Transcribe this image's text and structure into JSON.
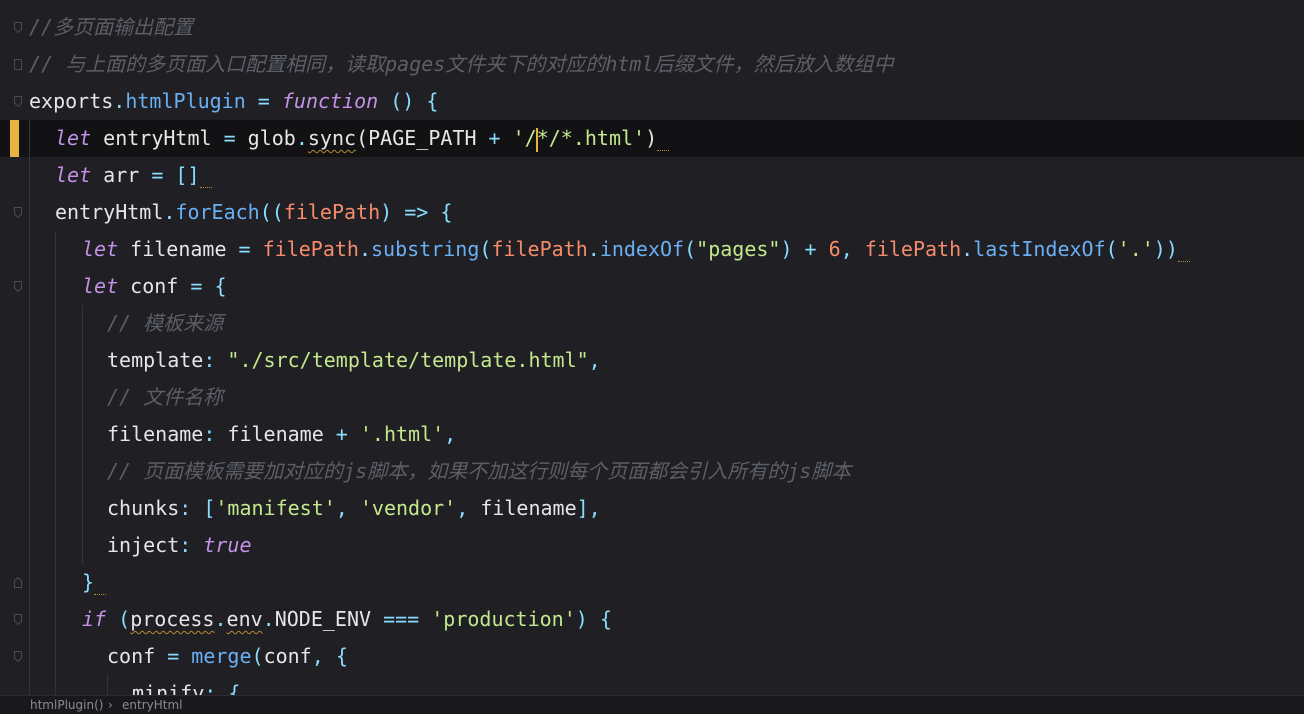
{
  "lines": [
    {
      "tokens": [
        {
          "t": "//多页面输出配置",
          "c": "comment"
        }
      ]
    },
    {
      "tokens": [
        {
          "t": "// 与上面的多页面入口配置相同，读取pages文件夹下的对应的html后缀文件，然后放入数组中",
          "c": "comment"
        }
      ]
    },
    {
      "tokens": [
        {
          "t": "exports",
          "c": "var"
        },
        {
          "t": ".",
          "c": "punc"
        },
        {
          "t": "htmlPlugin",
          "c": "fn"
        },
        {
          "t": " = ",
          "c": "op"
        },
        {
          "t": "function",
          "c": "kw"
        },
        {
          "t": " () {",
          "c": "punc"
        }
      ]
    },
    {
      "tokens": [
        {
          "t": "let",
          "c": "kw"
        },
        {
          "t": " entryHtml ",
          "c": "var"
        },
        {
          "t": "=",
          "c": "op"
        },
        {
          "t": " glob",
          "c": "var"
        },
        {
          "t": ".",
          "c": "punc"
        },
        {
          "t": "sync",
          "c": "var",
          "sq": true
        },
        {
          "t": "(",
          "c": "var"
        },
        {
          "t": "PAGE_PATH ",
          "c": "var"
        },
        {
          "t": "+",
          "c": "op"
        },
        {
          "t": " '",
          "c": "str"
        },
        {
          "t": "/",
          "c": "str"
        },
        {
          "t": "CARET",
          "c": "caret"
        },
        {
          "t": "*/*.html'",
          "c": "str"
        },
        {
          "t": ")",
          "c": "var"
        },
        {
          "t": "WARN",
          "c": "warn"
        }
      ]
    },
    {
      "tokens": [
        {
          "t": "let",
          "c": "kw"
        },
        {
          "t": " arr ",
          "c": "var"
        },
        {
          "t": "=",
          "c": "op"
        },
        {
          "t": " []",
          "c": "punc"
        },
        {
          "t": "WARN",
          "c": "warn"
        }
      ]
    },
    {
      "tokens": [
        {
          "t": "entryHtml",
          "c": "var"
        },
        {
          "t": ".",
          "c": "punc"
        },
        {
          "t": "forEach",
          "c": "fn"
        },
        {
          "t": "((",
          "c": "punc"
        },
        {
          "t": "filePath",
          "c": "param"
        },
        {
          "t": ") ",
          "c": "punc"
        },
        {
          "t": "=>",
          "c": "op"
        },
        {
          "t": " {",
          "c": "punc"
        }
      ]
    },
    {
      "tokens": [
        {
          "t": "let",
          "c": "kw"
        },
        {
          "t": " filename ",
          "c": "var"
        },
        {
          "t": "=",
          "c": "op"
        },
        {
          "t": " filePath",
          "c": "param"
        },
        {
          "t": ".",
          "c": "punc"
        },
        {
          "t": "substring",
          "c": "fn"
        },
        {
          "t": "(",
          "c": "punc"
        },
        {
          "t": "filePath",
          "c": "param"
        },
        {
          "t": ".",
          "c": "punc"
        },
        {
          "t": "indexOf",
          "c": "fn"
        },
        {
          "t": "(",
          "c": "punc"
        },
        {
          "t": "\"pages\"",
          "c": "str"
        },
        {
          "t": ") ",
          "c": "punc"
        },
        {
          "t": "+",
          "c": "op"
        },
        {
          "t": " 6",
          "c": "num"
        },
        {
          "t": ", ",
          "c": "punc"
        },
        {
          "t": "filePath",
          "c": "param"
        },
        {
          "t": ".",
          "c": "punc"
        },
        {
          "t": "lastIndexOf",
          "c": "fn"
        },
        {
          "t": "(",
          "c": "punc"
        },
        {
          "t": "'.'",
          "c": "str"
        },
        {
          "t": "))",
          "c": "punc"
        },
        {
          "t": "WARN",
          "c": "warn"
        }
      ]
    },
    {
      "tokens": [
        {
          "t": "let",
          "c": "kw"
        },
        {
          "t": " conf ",
          "c": "var"
        },
        {
          "t": "=",
          "c": "op"
        },
        {
          "t": " {",
          "c": "punc"
        }
      ]
    },
    {
      "tokens": [
        {
          "t": "// 模板来源",
          "c": "comment"
        }
      ]
    },
    {
      "tokens": [
        {
          "t": "template",
          "c": "prop"
        },
        {
          "t": ": ",
          "c": "punc"
        },
        {
          "t": "\"./src/template/template.html\"",
          "c": "str"
        },
        {
          "t": ",",
          "c": "punc"
        }
      ]
    },
    {
      "tokens": [
        {
          "t": "// 文件名称",
          "c": "comment"
        }
      ]
    },
    {
      "tokens": [
        {
          "t": "filename",
          "c": "prop"
        },
        {
          "t": ": ",
          "c": "punc"
        },
        {
          "t": "filename ",
          "c": "var"
        },
        {
          "t": "+",
          "c": "op"
        },
        {
          "t": " '.html'",
          "c": "str"
        },
        {
          "t": ",",
          "c": "punc"
        }
      ]
    },
    {
      "tokens": [
        {
          "t": "// 页面模板需要加对应的js脚本，如果不加这行则每个页面都会引入所有的js脚本",
          "c": "comment"
        }
      ]
    },
    {
      "tokens": [
        {
          "t": "chunks",
          "c": "prop"
        },
        {
          "t": ": [",
          "c": "punc"
        },
        {
          "t": "'manifest'",
          "c": "str"
        },
        {
          "t": ", ",
          "c": "punc"
        },
        {
          "t": "'vendor'",
          "c": "str"
        },
        {
          "t": ", ",
          "c": "punc"
        },
        {
          "t": "filename",
          "c": "var"
        },
        {
          "t": "],",
          "c": "punc"
        }
      ]
    },
    {
      "tokens": [
        {
          "t": "inject",
          "c": "prop"
        },
        {
          "t": ": ",
          "c": "punc"
        },
        {
          "t": "true",
          "c": "bool"
        }
      ]
    },
    {
      "tokens": [
        {
          "t": "}",
          "c": "punc"
        },
        {
          "t": "WARN",
          "c": "warn"
        }
      ]
    },
    {
      "tokens": [
        {
          "t": "if",
          "c": "kw"
        },
        {
          "t": " (",
          "c": "punc"
        },
        {
          "t": "process",
          "c": "var",
          "sq": true
        },
        {
          "t": ".",
          "c": "punc"
        },
        {
          "t": "env",
          "c": "var",
          "sq": true
        },
        {
          "t": ".",
          "c": "punc"
        },
        {
          "t": "NODE_ENV ",
          "c": "var"
        },
        {
          "t": "===",
          "c": "op"
        },
        {
          "t": " 'production'",
          "c": "str"
        },
        {
          "t": ") {",
          "c": "punc"
        }
      ]
    },
    {
      "tokens": [
        {
          "t": "conf ",
          "c": "var"
        },
        {
          "t": "=",
          "c": "op"
        },
        {
          "t": " merge",
          "c": "fn"
        },
        {
          "t": "(",
          "c": "punc"
        },
        {
          "t": "conf",
          "c": "var"
        },
        {
          "t": ", {",
          "c": "punc"
        }
      ]
    },
    {
      "tokens": [
        {
          "t": "minify",
          "c": "prop"
        },
        {
          "t": ": {",
          "c": "punc"
        }
      ]
    }
  ],
  "breadcrumb": {
    "items": [
      "htmlPlugin()",
      "entryHtml"
    ],
    "separator": "›"
  },
  "colors": {
    "background": "#1f1f24",
    "current_line": "#121215",
    "change_marker": "#e9b344"
  }
}
